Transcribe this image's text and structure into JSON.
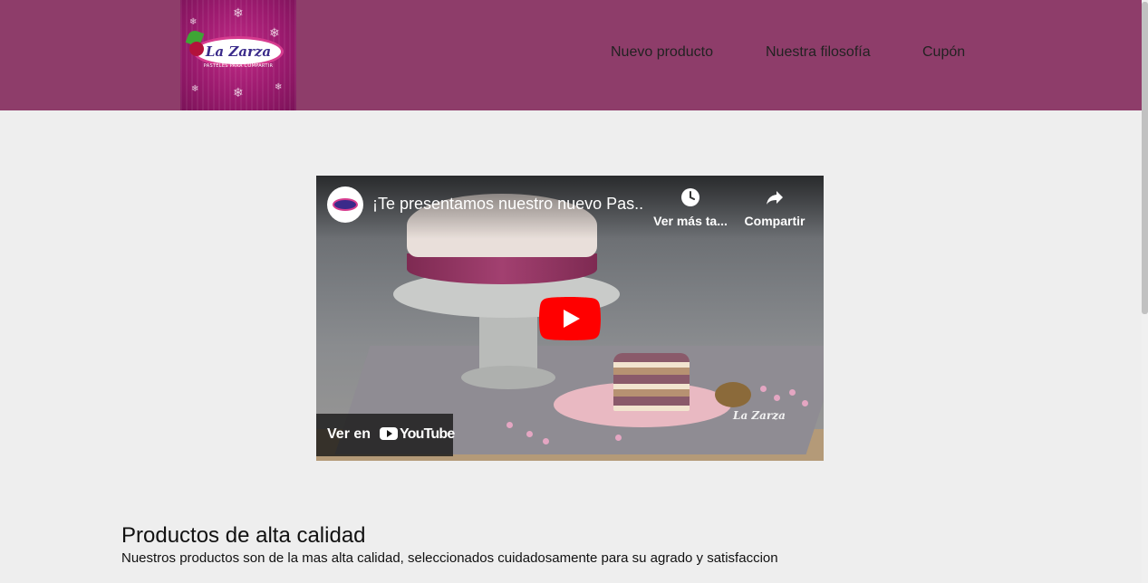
{
  "header": {
    "logo": {
      "brand": "La Zarza",
      "tagline": "PASTELES PARA COMPARTIR",
      "icon": "snowflake-icon"
    },
    "nav": [
      {
        "label": "Nuevo producto"
      },
      {
        "label": "Nuestra filosofía"
      },
      {
        "label": "Cupón"
      }
    ],
    "background_color": "#8e3d6a"
  },
  "video": {
    "title": "¡Te presentamos nuestro nuevo Pas...",
    "channel_avatar": "la-zarza-logo",
    "watch_later_label": "Ver más ta...",
    "share_label": "Compartir",
    "watch_on_label": "Ver en",
    "platform_label": "YouTube",
    "watermark": "La Zarza",
    "play_button_color": "#ff0000"
  },
  "section": {
    "title": "Productos de alta calidad",
    "text": "Nuestros productos son de la mas alta calidad, seleccionados cuidadosamente para su agrado y satisfaccion"
  }
}
